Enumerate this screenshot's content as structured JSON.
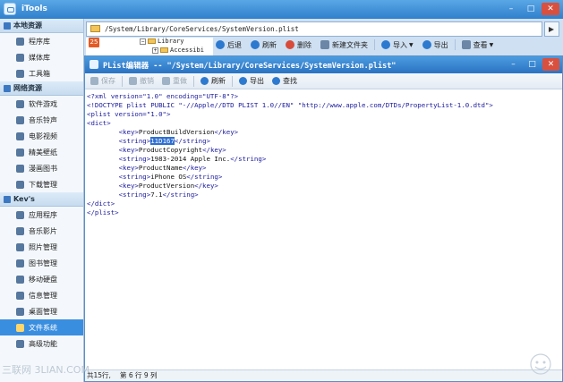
{
  "app": {
    "title": "iTools"
  },
  "sidebar": {
    "sections": [
      {
        "title": "本地资源",
        "items": [
          {
            "label": "程序库",
            "icon": "apps-icon"
          },
          {
            "label": "媒体库",
            "icon": "media-icon"
          },
          {
            "label": "工具箱",
            "icon": "tools-icon"
          }
        ]
      },
      {
        "title": "网络资源",
        "items": [
          {
            "label": "软件游戏",
            "icon": "game-icon"
          },
          {
            "label": "音乐铃声",
            "icon": "music-icon"
          },
          {
            "label": "电影视频",
            "icon": "video-icon"
          },
          {
            "label": "精美壁纸",
            "icon": "wallpaper-icon"
          },
          {
            "label": "漫画图书",
            "icon": "comic-icon"
          },
          {
            "label": "下载管理",
            "icon": "download-icon"
          }
        ]
      },
      {
        "title": "Kev's",
        "items": [
          {
            "label": "应用程序",
            "icon": "app-icon"
          },
          {
            "label": "音乐影片",
            "icon": "music-video-icon"
          },
          {
            "label": "照片管理",
            "icon": "photo-icon"
          },
          {
            "label": "图书管理",
            "icon": "book-icon"
          },
          {
            "label": "移动硬盘",
            "icon": "drive-icon"
          },
          {
            "label": "信息管理",
            "icon": "message-icon"
          },
          {
            "label": "桌面管理",
            "icon": "desktop-icon"
          },
          {
            "label": "文件系统",
            "icon": "folder-icon",
            "active": true
          },
          {
            "label": "高级功能",
            "icon": "advanced-icon"
          }
        ]
      }
    ]
  },
  "path": {
    "value": "/System/Library/CoreServices/SystemVersion.plist"
  },
  "tree": {
    "badge": "25",
    "row1": "Library",
    "row2": "Accessibi"
  },
  "toolbar": {
    "back": "后退",
    "refresh": "刷新",
    "delete": "删除",
    "new_folder": "新建文件夹",
    "import": "导入",
    "export": "导出",
    "view": "查看"
  },
  "editor": {
    "title": "PList编辑器  --  \"/System/Library/CoreServices/SystemVersion.plist\"",
    "toolbar": {
      "save": "保存",
      "undo": "撤销",
      "redo": "重做",
      "refresh": "刷新",
      "export": "导出",
      "find": "查找"
    },
    "lines": [
      "<?xml version=\"1.0\" encoding=\"UTF-8\"?>",
      "<!DOCTYPE plist PUBLIC \"-//Apple//DTD PLIST 1.0//EN\" \"http://www.apple.com/DTDs/PropertyList-1.0.dtd\">",
      "<plist version=\"1.0\">",
      "<dict>",
      "        <key>ProductBuildVersion</key>",
      "        <string>11D167</string>",
      "        <key>ProductCopyright</key>",
      "        <string>1983-2014 Apple Inc.</string>",
      "        <key>ProductName</key>",
      "        <string>iPhone OS</string>",
      "        <key>ProductVersion</key>",
      "        <string>7.1</string>",
      "</dict>",
      "</plist>"
    ],
    "status": {
      "total": "共15行,",
      "position": "第 6 行 9 列"
    }
  },
  "watermark": "三联网 3LIAN.COM"
}
